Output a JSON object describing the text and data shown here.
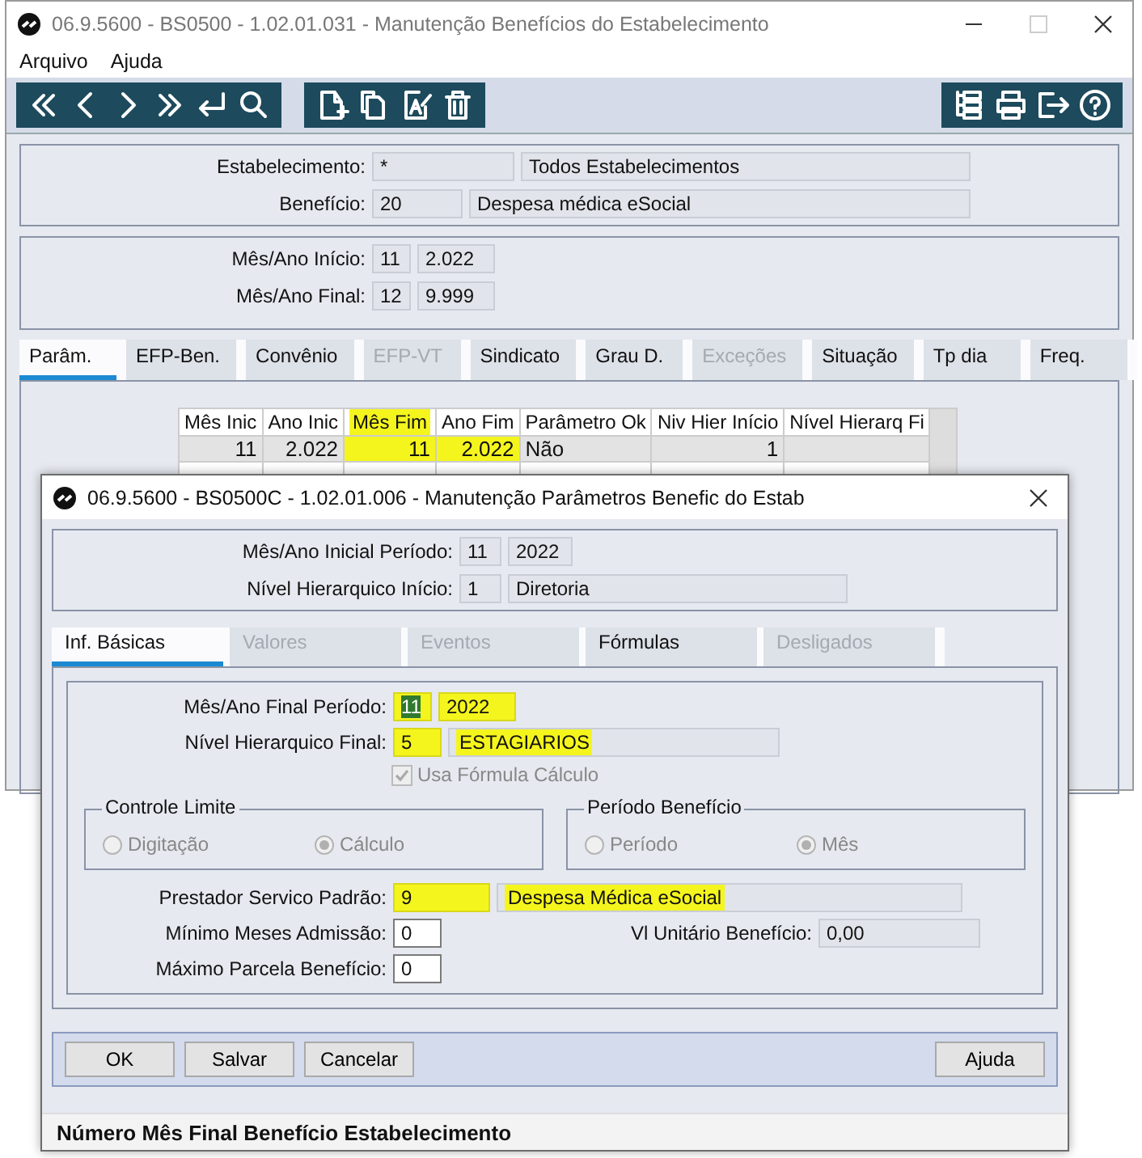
{
  "main_window": {
    "title": "06.9.5600 - BS0500 - 1.02.01.031 - Manutenção Benefícios do Estabelecimento",
    "menu": [
      "Arquivo",
      "Ajuda"
    ],
    "header_fields": [
      {
        "label": "Estabelecimento:",
        "code": "*",
        "description": "Todos Estabelecimentos"
      },
      {
        "label": "Benefício:",
        "code": "20",
        "description": "Despesa médica eSocial"
      }
    ],
    "period_fields": [
      {
        "label": "Mês/Ano Início:",
        "month": "11",
        "year": "2.022"
      },
      {
        "label": "Mês/Ano Final:",
        "month": "12",
        "year": "9.999"
      }
    ],
    "tabs": [
      {
        "label": "Parâm.",
        "selected": true,
        "disabled": false
      },
      {
        "label": "EFP-Ben.",
        "selected": false,
        "disabled": false
      },
      {
        "label": "Convênio",
        "selected": false,
        "disabled": false
      },
      {
        "label": "EFP-VT",
        "selected": false,
        "disabled": true
      },
      {
        "label": "Sindicato",
        "selected": false,
        "disabled": false
      },
      {
        "label": "Grau D.",
        "selected": false,
        "disabled": false
      },
      {
        "label": "Exceções",
        "selected": false,
        "disabled": true
      },
      {
        "label": "Situação",
        "selected": false,
        "disabled": false
      },
      {
        "label": "Tp dia",
        "selected": false,
        "disabled": false
      },
      {
        "label": "Freq.",
        "selected": false,
        "disabled": false
      }
    ],
    "table": {
      "columns": [
        {
          "label": "Mês Inic",
          "kind": "number",
          "highlighted": false
        },
        {
          "label": "Ano Inic",
          "kind": "number",
          "highlighted": false
        },
        {
          "label": "Mês Fim",
          "kind": "number",
          "highlighted": true
        },
        {
          "label": "Ano Fim",
          "kind": "number",
          "highlighted": false
        },
        {
          "label": "Parâmetro Ok",
          "kind": "text",
          "highlighted": false
        },
        {
          "label": "Niv Hier Início",
          "kind": "number",
          "highlighted": false
        },
        {
          "label": "Nível Hierarq Fi",
          "kind": "number",
          "highlighted": false
        }
      ],
      "rows": [
        {
          "selected": true,
          "cells": [
            {
              "text": "11",
              "highlighted": false
            },
            {
              "text": "2.022",
              "highlighted": false
            },
            {
              "text": "11",
              "highlighted": true
            },
            {
              "text": "2.022",
              "highlighted": true
            },
            {
              "text": "Não",
              "highlighted": false
            },
            {
              "text": "1",
              "highlighted": false
            },
            {
              "text": "",
              "highlighted": false
            }
          ]
        }
      ]
    }
  },
  "dialog": {
    "title": "06.9.5600 - BS0500C - 1.02.01.006 - Manutenção Parâmetros Benefic do Estab",
    "header_fields": [
      {
        "label": "Mês/Ano Inicial Período:",
        "kind": "period",
        "code": "11",
        "description": "2022"
      },
      {
        "label": "Nível Hierarquico Início:",
        "kind": "lookup",
        "code": "1",
        "description": "Diretoria"
      }
    ],
    "tabs": [
      {
        "label": "Inf. Básicas",
        "selected": true,
        "disabled": false
      },
      {
        "label": "Valores",
        "selected": false,
        "disabled": true
      },
      {
        "label": "Eventos",
        "selected": false,
        "disabled": true
      },
      {
        "label": "Fórmulas",
        "selected": false,
        "disabled": false
      },
      {
        "label": "Desligados",
        "selected": false,
        "disabled": true
      }
    ],
    "final_period": {
      "label": "Mês/Ano Final Período:",
      "month": {
        "value": "11",
        "highlighted": true,
        "focused": true
      },
      "year": {
        "value": "2022",
        "highlighted": true
      }
    },
    "final_level": {
      "label": "Nível Hierarquico Final:",
      "code": {
        "value": "5",
        "highlighted": true
      },
      "description": {
        "value": "ESTAGIARIOS",
        "highlighted": true
      }
    },
    "use_formula": {
      "label": "Usa Fórmula Cálculo",
      "checked": true,
      "disabled": true
    },
    "groups": [
      {
        "title": "Controle Limite",
        "disabled": true,
        "options": [
          {
            "label": "Digitação",
            "selected": false
          },
          {
            "label": "Cálculo",
            "selected": true
          }
        ]
      },
      {
        "title": "Período Benefício",
        "disabled": true,
        "options": [
          {
            "label": "Período",
            "selected": false
          },
          {
            "label": "Mês",
            "selected": true
          }
        ]
      }
    ],
    "provider": {
      "label": "Prestador Servico Padrão:",
      "code": {
        "value": "9",
        "highlighted": true
      },
      "description": {
        "value": "Despesa Médica eSocial",
        "highlighted": true
      }
    },
    "min_months": {
      "label": "Mínimo Meses Admissão:",
      "value": "0"
    },
    "unit_value": {
      "label": "Vl Unitário Benefício:",
      "value": "0,00"
    },
    "max_installments": {
      "label": "Máximo Parcela Benefício:",
      "value": "0"
    },
    "buttons_left": [
      "OK",
      "Salvar",
      "Cancelar"
    ],
    "buttons_right": [
      "Ajuda"
    ],
    "status_bar": "Número Mês Final Benefício Estabelecimento"
  }
}
